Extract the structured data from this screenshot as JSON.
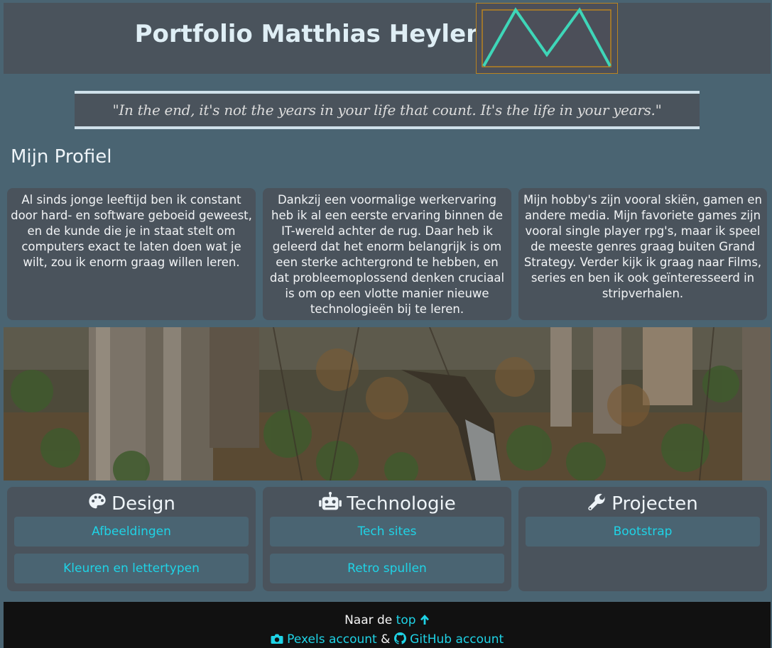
{
  "header": {
    "title": "Portfolio Matthias Heylen"
  },
  "quote": "\"In the end, it's not the years in your life that count. It's the life in your years.\"",
  "profile": {
    "title": "Mijn Profiel",
    "cards": [
      "Al sinds jonge leeftijd ben ik constant door hard- en software geboeid geweest, en de kunde die je in staat stelt om computers exact te laten doen wat je wilt, zou ik enorm graag willen leren.",
      "Dankzij een voormalige werkervaring heb ik al een eerste ervaring binnen de IT-wereld achter de rug. Daar heb ik geleerd dat het enorm belangrijk is om een sterke achtergrond te hebben, en dat probleemoplossend denken cruciaal is om op een vlotte manier nieuwe technologieën bij te leren.",
      "Mijn hobby's zijn vooral skiën, gamen en andere media. Mijn favoriete games zijn vooral single player rpg's, maar ik speel de meeste genres graag buiten Grand Strategy. Verder kijk ik graag naar Films, series en ben ik ook geïnteresseerd in stripverhalen."
    ]
  },
  "sections": [
    {
      "title": "Design",
      "icon": "palette-icon",
      "links": [
        "Afbeeldingen",
        "Kleuren en lettertypen"
      ]
    },
    {
      "title": "Technologie",
      "icon": "robot-icon",
      "links": [
        "Tech sites",
        "Retro spullen"
      ]
    },
    {
      "title": "Projecten",
      "icon": "wrench-icon",
      "links": [
        "Bootstrap"
      ]
    }
  ],
  "footer": {
    "to_top_prefix": "Naar de",
    "to_top_link": "top",
    "pexels_link": "Pexels account",
    "separator": "&",
    "github_link": "GitHub account"
  },
  "colors": {
    "background": "#4a6472",
    "panel": "#4a535c",
    "accent": "#1fd3e6",
    "logo_stroke": "#3ed6b8",
    "logo_border": "#b98420"
  }
}
